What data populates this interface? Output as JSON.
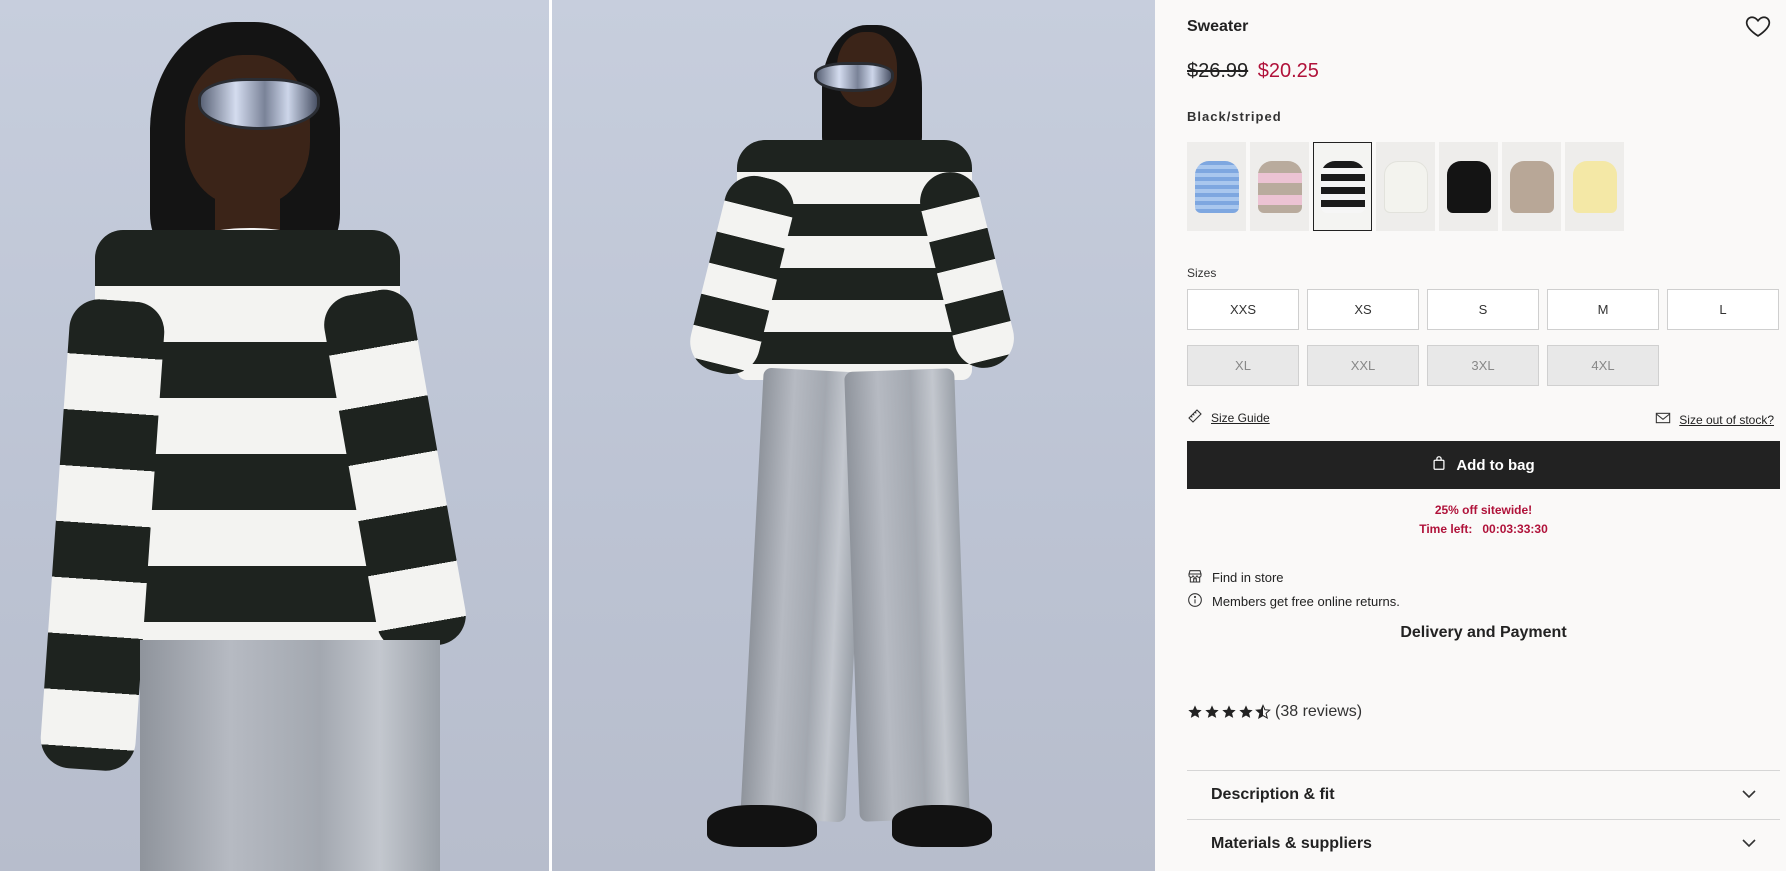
{
  "product": {
    "title": "Sweater",
    "price_old": "$26.99",
    "price_new": "$20.25",
    "color_name": "Black/striped"
  },
  "swatches": [
    {
      "name": "light-blue",
      "color": "#8fb4e6"
    },
    {
      "name": "beige-pink-striped",
      "color": "#c9bdb3"
    },
    {
      "name": "black-striped",
      "color": "#1e1e1e",
      "selected": true
    },
    {
      "name": "white",
      "color": "#f1f1ec"
    },
    {
      "name": "black",
      "color": "#141414"
    },
    {
      "name": "beige",
      "color": "#b9a898"
    },
    {
      "name": "light-yellow",
      "color": "#f3e7a4"
    }
  ],
  "sizes": {
    "label": "Sizes",
    "available": [
      "XXS",
      "XS",
      "S",
      "M",
      "L"
    ],
    "unavailable": [
      "XL",
      "XXL",
      "3XL",
      "4XL"
    ]
  },
  "links": {
    "size_guide": "Size Guide",
    "size_out_of_stock": "Size out of stock?"
  },
  "add_to_bag": "Add to bag",
  "promo": {
    "line1": "25% off sitewide!",
    "time_left_label": "Time left:",
    "timer": "00:03:33:30"
  },
  "info": {
    "find_in_store": "Find in store",
    "free_returns": "Members get free online returns."
  },
  "delivery_title": "Delivery and Payment",
  "rating": {
    "stars": 4.5,
    "reviews": "(38 reviews)"
  },
  "accordions": [
    "Description & fit",
    "Materials & suppliers"
  ],
  "colors": {
    "sale_red": "#b0123a",
    "button_dark": "#222222"
  }
}
